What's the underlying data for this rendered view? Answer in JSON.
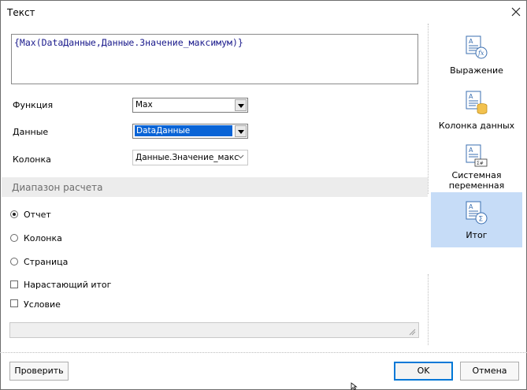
{
  "window": {
    "title": "Текст"
  },
  "expression": {
    "value": "{Max(DataДанные,Данные.Значение_максимум)}"
  },
  "form": {
    "function_label": "Функция",
    "function_value": "Max",
    "data_label": "Данные",
    "data_value": "DataДанные",
    "column_label": "Колонка",
    "column_value": "Данные.Значение_макс"
  },
  "range": {
    "header": "Диапазон расчета",
    "options": [
      "Отчет",
      "Колонка",
      "Страница"
    ],
    "selected": "Отчет"
  },
  "checks": {
    "running_total": "Нарастающий итог",
    "condition": "Условие"
  },
  "sidebar": {
    "items": [
      {
        "label": "Выражение",
        "icon": "expression-icon"
      },
      {
        "label": "Колонка данных",
        "icon": "data-column-icon"
      },
      {
        "label": "Системная переменная",
        "icon": "system-variable-icon"
      },
      {
        "label": "Итог",
        "icon": "total-icon",
        "active": true
      }
    ]
  },
  "buttons": {
    "check": "Проверить",
    "ok": "OK",
    "cancel": "Отмена"
  },
  "colors": {
    "accent": "#0a64d6",
    "active_bg": "#c6dcf7",
    "expr_text": "#1a1a8c"
  }
}
